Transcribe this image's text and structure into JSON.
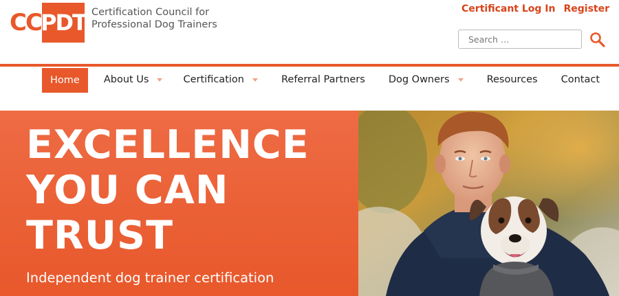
{
  "brand": {
    "logo_letters_a": "CC",
    "logo_letters_b": "PDT",
    "tagline_line1": "Certification Council for",
    "tagline_line2": "Professional Dog Trainers",
    "accent_color": "#e8582b"
  },
  "top_links": {
    "login": "Certificant Log In",
    "register": "Register"
  },
  "search": {
    "placeholder": "Search …",
    "icon": "search-icon"
  },
  "nav": {
    "items": [
      {
        "label": "Home",
        "active": true,
        "dropdown": false
      },
      {
        "label": "About Us",
        "active": false,
        "dropdown": true
      },
      {
        "label": "Certification",
        "active": false,
        "dropdown": true
      },
      {
        "label": "Referral Partners",
        "active": false,
        "dropdown": false
      },
      {
        "label": "Dog Owners",
        "active": false,
        "dropdown": true
      },
      {
        "label": "Resources",
        "active": false,
        "dropdown": false
      },
      {
        "label": "Contact",
        "active": false,
        "dropdown": false
      }
    ]
  },
  "hero": {
    "title_line1": "EXCELLENCE",
    "title_line2": "YOU CAN",
    "title_line3": "TRUST",
    "subtitle": "Independent dog trainer certification"
  }
}
